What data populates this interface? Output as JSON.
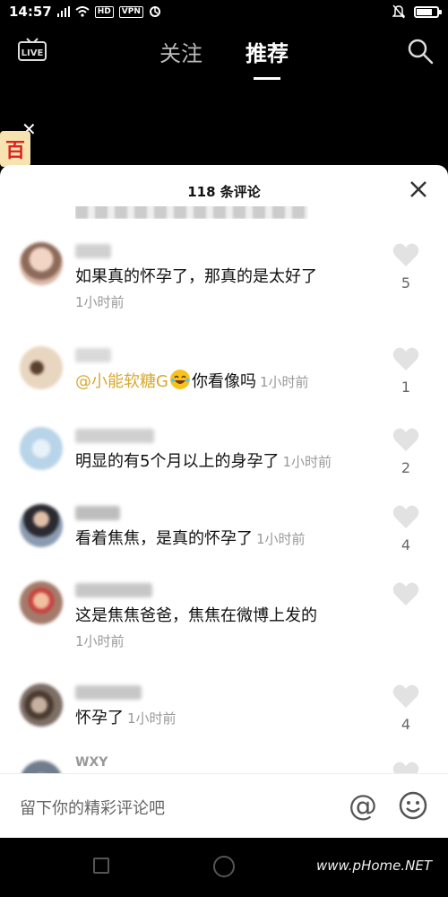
{
  "status_bar": {
    "time": "14:57",
    "network_tags": [
      "HD",
      "VPN"
    ]
  },
  "top_nav": {
    "live_label": "LIVE",
    "tabs": [
      {
        "label": "关注",
        "active": false
      },
      {
        "label": "推荐",
        "active": true
      }
    ]
  },
  "side_badge": {
    "text": "百"
  },
  "comments_panel": {
    "title": "118 条评论",
    "comments": [
      {
        "text": "如果真的怀孕了，那真的是太好了",
        "time": "1小时前",
        "likes": "5",
        "avatar_color": "#d9b7a6"
      },
      {
        "mention": "@小能软糖G",
        "emoji": "laughing-tears",
        "text": "你看像吗",
        "time": "1小时前",
        "likes": "1",
        "avatar_color": "#c9a88a"
      },
      {
        "text": "明显的有5个月以上的身孕了",
        "time": "1小时前",
        "likes": "2",
        "avatar_color": "#b8d4e8"
      },
      {
        "text": "看着焦焦，是真的怀孕了",
        "time": "1小时前",
        "likes": "4",
        "avatar_color": "#8a9bb0"
      },
      {
        "text": "这是焦焦爸爸，焦焦在微博上发的",
        "time": "1小时前",
        "likes": "",
        "avatar_color": "#a47b6a"
      },
      {
        "text": "怀孕了",
        "time": "1小时前",
        "likes": "4",
        "avatar_color": "#7d6e66"
      },
      {
        "username": "WXY",
        "avatar_color": "#6f7d8c"
      }
    ]
  },
  "input_bar": {
    "placeholder": "留下你的精彩评论吧",
    "at_symbol": "@"
  },
  "watermark": "www.pHome.NET",
  "colors": {
    "mention": "#d8a830",
    "muted_text": "#999999",
    "like_heart": "#e2e2e2"
  }
}
